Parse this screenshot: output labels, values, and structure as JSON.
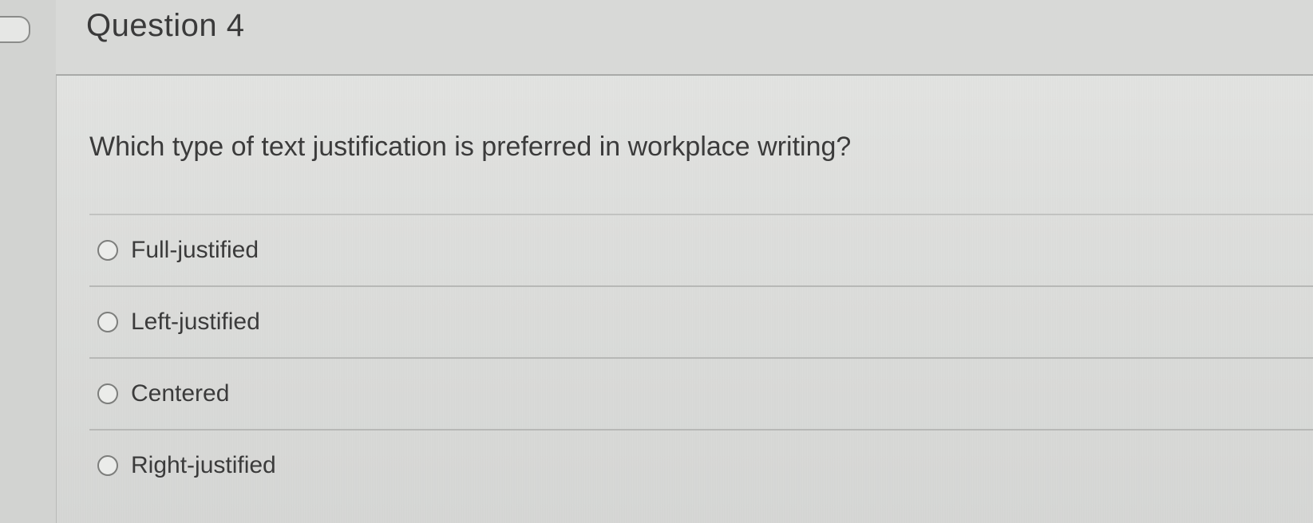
{
  "question": {
    "title": "Question 4",
    "prompt": "Which type of text justification is preferred in workplace writing?"
  },
  "answers": [
    {
      "label": "Full-justified",
      "selected": false
    },
    {
      "label": "Left-justified",
      "selected": false
    },
    {
      "label": "Centered",
      "selected": false
    },
    {
      "label": "Right-justified",
      "selected": false
    }
  ],
  "colors": {
    "background": "#d9dad8",
    "text": "#3b3b3b",
    "divider": "#b7b8b6"
  }
}
